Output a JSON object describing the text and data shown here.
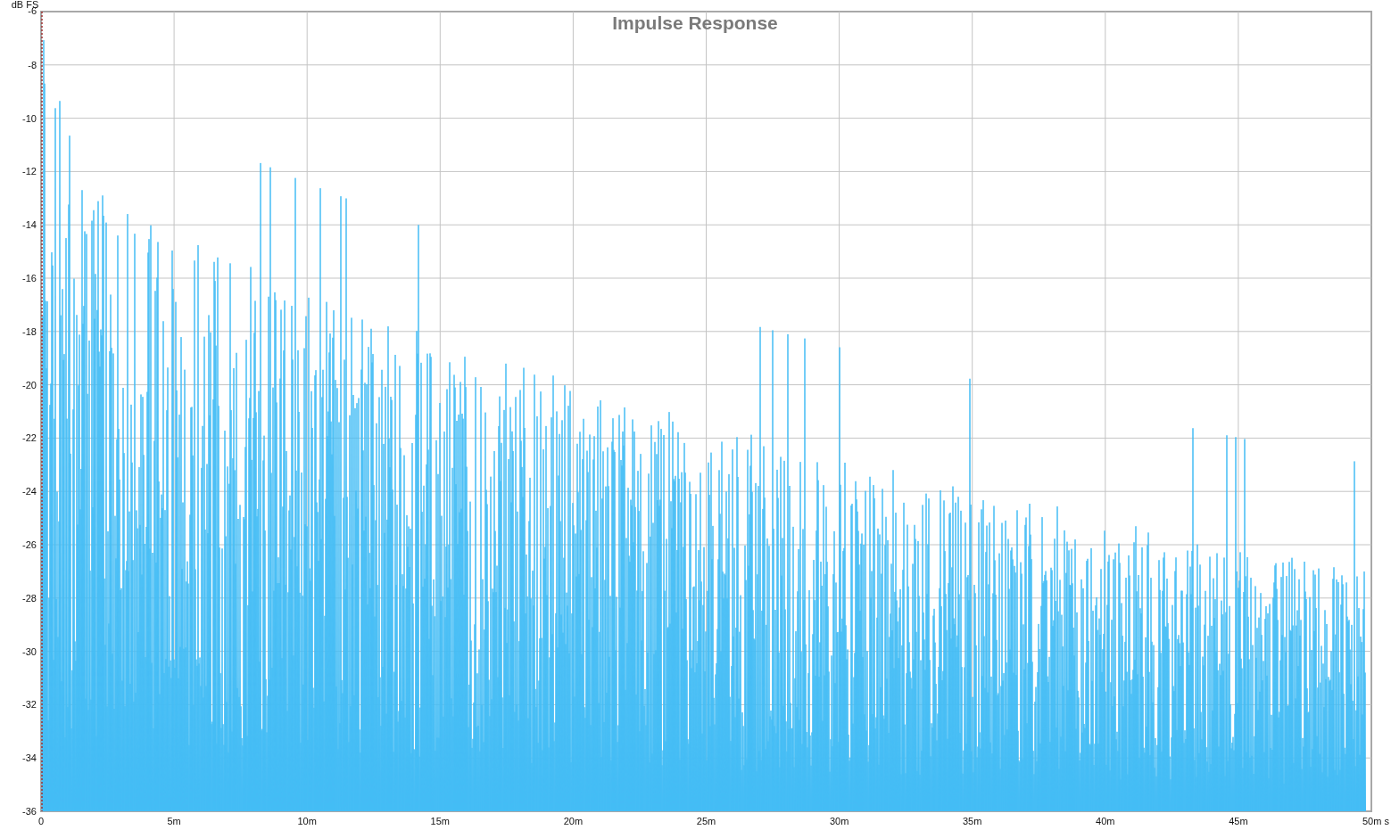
{
  "chart": {
    "title": "Impulse Response",
    "y_axis": {
      "unit": "dB FS",
      "ticks": [
        "-6",
        "-8",
        "-10",
        "-12",
        "-14",
        "-16",
        "-18",
        "-20",
        "-22",
        "-24",
        "-26",
        "-28",
        "-30",
        "-32",
        "-34",
        "-36"
      ]
    },
    "x_axis": {
      "ticks": [
        "0",
        "5m",
        "10m",
        "15m",
        "20m",
        "25m",
        "30m",
        "35m",
        "40m",
        "45m",
        "50m s"
      ]
    }
  }
}
